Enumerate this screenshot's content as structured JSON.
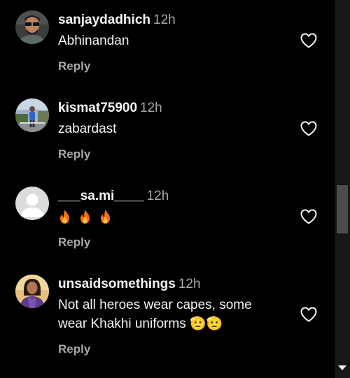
{
  "comments": [
    {
      "username": "sanjaydadhich",
      "time": "12h",
      "text": "Abhinandan",
      "reply_label": "Reply"
    },
    {
      "username": "kismat75900",
      "time": "12h",
      "text": "zabardast",
      "reply_label": "Reply"
    },
    {
      "username": "___sa.mi____",
      "time": "12h",
      "text": "🔥 🔥 🔥",
      "reply_label": "Reply"
    },
    {
      "username": "unsaidsomethings",
      "time": "12h",
      "text": "Not all heroes wear capes, some wear Khakhi uniforms 🫡🫡",
      "reply_label": "Reply"
    }
  ],
  "colors": {
    "background": "#000000",
    "primary_text": "#f5f5f5",
    "secondary_text": "#a8a8a8",
    "flame": "#f56e1b"
  },
  "icons": {
    "like": "heart-outline-icon",
    "scroll_down": "triangle-down-icon"
  }
}
